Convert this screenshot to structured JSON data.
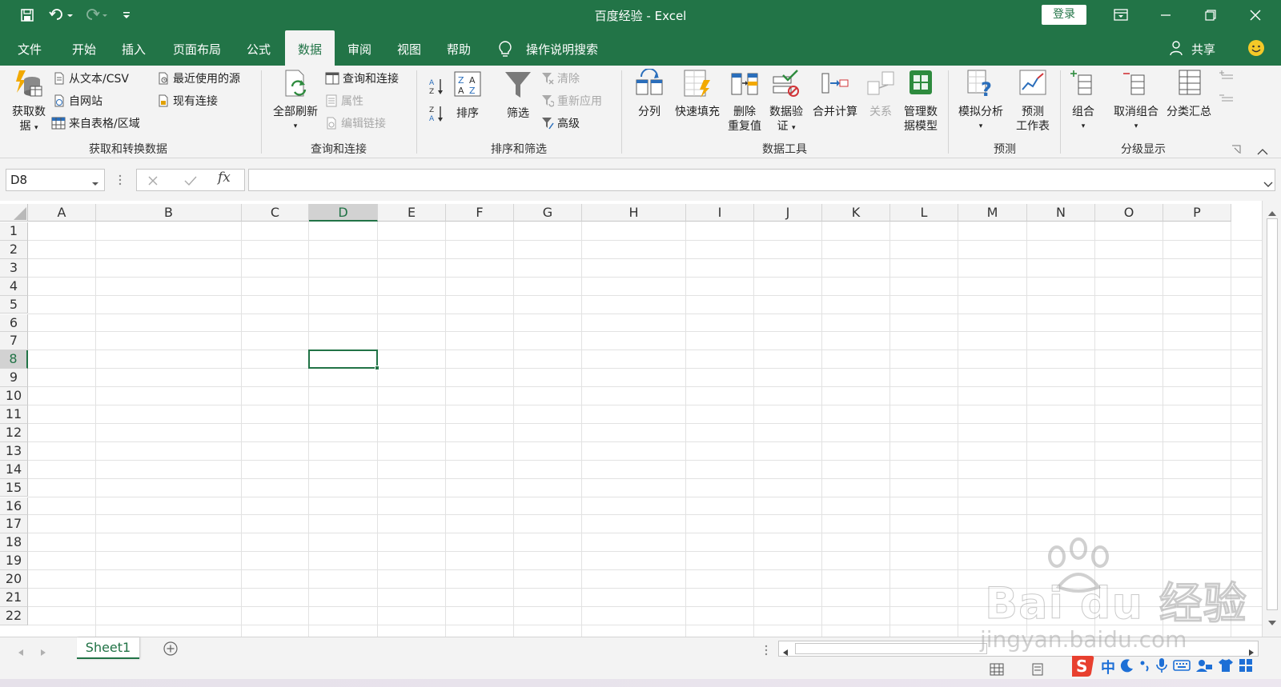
{
  "app": {
    "title": "百度经验 - Excel",
    "login_label": "登录",
    "share_label": "共享"
  },
  "colors": {
    "brand": "#227447",
    "selection": "#217346"
  },
  "tabs": [
    {
      "label": "文件"
    },
    {
      "label": "开始"
    },
    {
      "label": "插入"
    },
    {
      "label": "页面布局"
    },
    {
      "label": "公式"
    },
    {
      "label": "数据",
      "active": true
    },
    {
      "label": "审阅"
    },
    {
      "label": "视图"
    },
    {
      "label": "帮助"
    },
    {
      "label": "操作说明搜索"
    }
  ],
  "ribbon": {
    "get_transform": {
      "group_label": "获取和转换数据",
      "get_data_line1": "获取数",
      "get_data_line2": "据",
      "from_text": "从文本/CSV",
      "from_web": "自网站",
      "from_table": "来自表格/区域",
      "recent_sources": "最近使用的源",
      "existing_connections": "现有连接"
    },
    "queries": {
      "group_label": "查询和连接",
      "refresh_all": "全部刷新",
      "queries_connections": "查询和连接",
      "properties": "属性",
      "edit_links": "编辑链接"
    },
    "sort_filter": {
      "group_label": "排序和筛选",
      "sort": "排序",
      "filter": "筛选",
      "clear": "清除",
      "reapply": "重新应用",
      "advanced": "高级"
    },
    "data_tools": {
      "group_label": "数据工具",
      "text_to_columns": "分列",
      "flash_fill": "快速填充",
      "remove_dup_line1": "删除",
      "remove_dup_line2": "重复值",
      "validation_line1": "数据验",
      "validation_line2": "证",
      "consolidate": "合并计算",
      "relationships": "关系",
      "manage_model_line1": "管理数",
      "manage_model_line2": "据模型"
    },
    "forecast": {
      "group_label": "预测",
      "what_if": "模拟分析",
      "forecast_sheet_line1": "预测",
      "forecast_sheet_line2": "工作表"
    },
    "outline": {
      "group_label": "分级显示",
      "group": "组合",
      "ungroup": "取消组合",
      "subtotal": "分类汇总"
    }
  },
  "formula_bar": {
    "name_box": "D8",
    "formula": "",
    "fx_label": "fx"
  },
  "grid": {
    "columns": [
      "A",
      "B",
      "C",
      "D",
      "E",
      "F",
      "G",
      "H",
      "I",
      "J",
      "K",
      "L",
      "M",
      "N",
      "O",
      "P"
    ],
    "rows": [
      "1",
      "2",
      "3",
      "4",
      "5",
      "6",
      "7",
      "8",
      "9",
      "10",
      "11",
      "12",
      "13",
      "14",
      "15",
      "16",
      "17",
      "18",
      "19",
      "20",
      "21",
      "22"
    ],
    "selected_cell": "D8"
  },
  "sheets": [
    {
      "name": "Sheet1",
      "active": true
    }
  ],
  "watermark": {
    "line1": "Bai du 经验",
    "line2": "jingyan.baidu.com"
  },
  "ime": {
    "input_mode": "中"
  }
}
